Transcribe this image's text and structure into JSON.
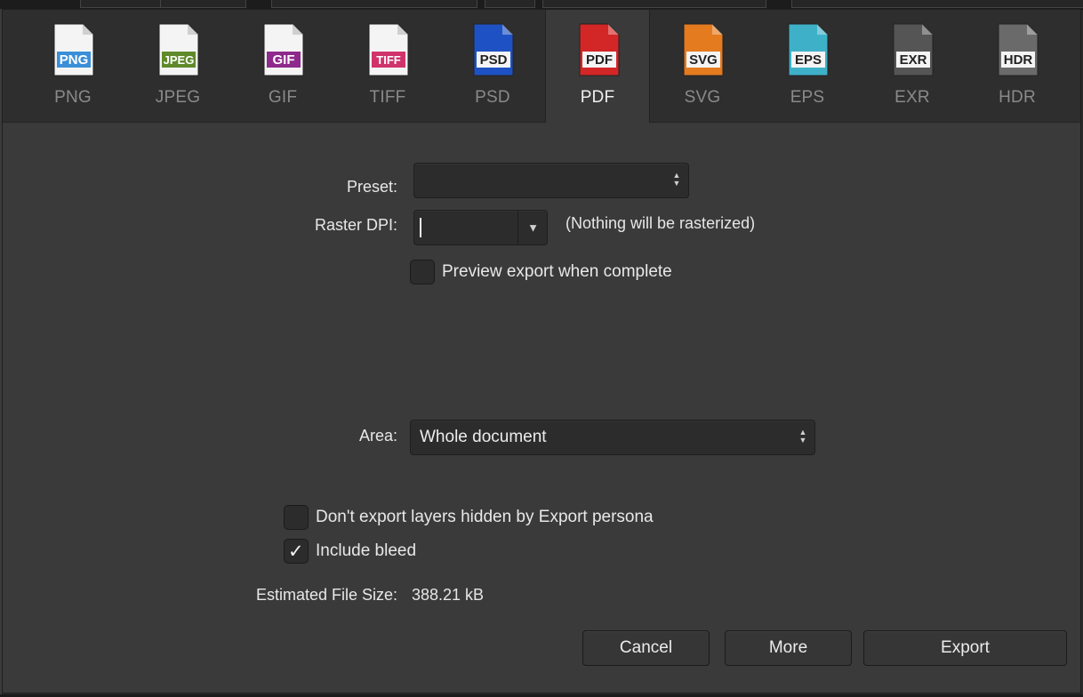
{
  "formats": [
    {
      "label": "PNG",
      "badge": "PNG",
      "color": "#3b8fd8"
    },
    {
      "label": "JPEG",
      "badge": "JPEG",
      "color": "#5f8a2b"
    },
    {
      "label": "GIF",
      "badge": "GIF",
      "color": "#8e2a8c"
    },
    {
      "label": "TIFF",
      "badge": "TIFF",
      "color": "#d0336a"
    },
    {
      "label": "PSD",
      "badge": "PSD",
      "color": "#1e52c4"
    },
    {
      "label": "PDF",
      "badge": "PDF",
      "color": "#d32626"
    },
    {
      "label": "SVG",
      "badge": "SVG",
      "color": "#e47b1f"
    },
    {
      "label": "EPS",
      "badge": "EPS",
      "color": "#3eb1c9"
    },
    {
      "label": "EXR",
      "badge": "EXR",
      "color": "#555555"
    },
    {
      "label": "HDR",
      "badge": "HDR",
      "color": "#6a6a6a"
    }
  ],
  "selected_format": "PDF",
  "preset": {
    "label": "Preset:",
    "value": ""
  },
  "raster_dpi": {
    "label": "Raster DPI:",
    "value": "",
    "note": "(Nothing will be rasterized)"
  },
  "preview_export": {
    "label": "Preview export when complete",
    "checked": false
  },
  "area": {
    "label": "Area:",
    "value": "Whole document"
  },
  "dont_export_hidden": {
    "label": "Don't export layers hidden by Export persona",
    "checked": false
  },
  "include_bleed": {
    "label": "Include bleed",
    "checked": true,
    "check_glyph": "✓"
  },
  "file_size": {
    "label": "Estimated File Size:",
    "value": "388.21 kB"
  },
  "buttons": {
    "cancel": "Cancel",
    "more": "More",
    "export": "Export"
  },
  "icons": {
    "stepper": "up-down-stepper-icon",
    "dropdown": "triangle-down-icon"
  }
}
